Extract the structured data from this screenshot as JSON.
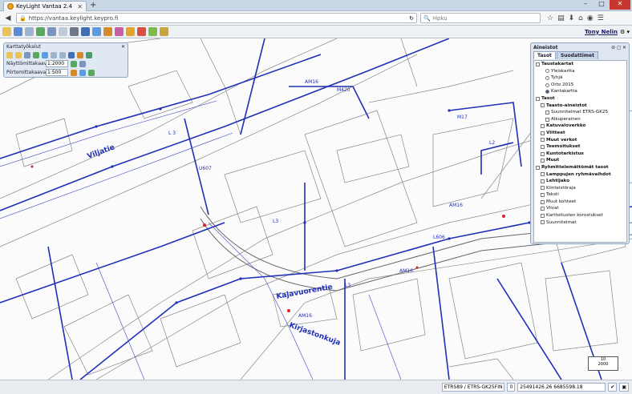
{
  "browser": {
    "tab_title": "KeyLight Vantaa 2.4",
    "new_tab": "+",
    "url": "https://vantaa.keylight.keypro.fi",
    "search_placeholder": "Hpku",
    "win_min": "–",
    "win_max": "□",
    "win_close": "✕"
  },
  "app": {
    "user": "Tony Nelin",
    "user_suffix": "⚙ ▾"
  },
  "tools": {
    "title": "Karttatyökalut",
    "close": "✕",
    "view_scale_label": "Näyttömittakaava",
    "view_scale_value": "1:2000",
    "draw_scale_label": "Piirtomittakaava",
    "draw_scale_value": "1:500"
  },
  "panel": {
    "title": "Aineistot",
    "controls": "⊘ ◻ ✕",
    "tabs": [
      "Tasot",
      "Suodattimet"
    ],
    "items": [
      {
        "kind": "tree",
        "label": "Taustakartat",
        "bold": true,
        "indent": 0
      },
      {
        "kind": "radio",
        "label": "Yleiskartta",
        "on": false,
        "indent": 2
      },
      {
        "kind": "radio",
        "label": "Tyhjä",
        "on": false,
        "indent": 2
      },
      {
        "kind": "radio",
        "label": "Orto 2015",
        "on": false,
        "indent": 2
      },
      {
        "kind": "radio",
        "label": "Kantakartta",
        "on": true,
        "indent": 2
      },
      {
        "kind": "check",
        "label": "Tasot",
        "bold": true,
        "indent": 0
      },
      {
        "kind": "check",
        "label": "Taasto-aineistot",
        "bold": true,
        "indent": 1
      },
      {
        "kind": "check",
        "label": "Suunnitelmat ETRS-GK25",
        "indent": 2
      },
      {
        "kind": "check",
        "label": "Alkuperainen",
        "indent": 2
      },
      {
        "kind": "check",
        "label": "Katuvaloverkko",
        "bold": true,
        "indent": 1
      },
      {
        "kind": "check",
        "label": "Viitteet",
        "bold": true,
        "indent": 1
      },
      {
        "kind": "check",
        "label": "Muut verkot",
        "bold": true,
        "indent": 1
      },
      {
        "kind": "check",
        "label": "Teemoitukset",
        "bold": true,
        "indent": 1
      },
      {
        "kind": "check",
        "label": "Kuntotarkistus",
        "bold": true,
        "indent": 1
      },
      {
        "kind": "check",
        "label": "Muut",
        "bold": true,
        "indent": 1
      },
      {
        "kind": "check",
        "label": "Ryhmittelemättömät tasot",
        "bold": true,
        "indent": 0
      },
      {
        "kind": "check",
        "label": "Lamppujen ryhmävaihdot",
        "bold": true,
        "indent": 1
      },
      {
        "kind": "check",
        "label": "Lehtijako",
        "bold": true,
        "indent": 1
      },
      {
        "kind": "check",
        "label": "Kiinteistöraja",
        "indent": 1
      },
      {
        "kind": "check",
        "label": "Teksti",
        "indent": 1
      },
      {
        "kind": "check",
        "label": "Muut kohteet",
        "indent": 1
      },
      {
        "kind": "check",
        "label": "Viivat",
        "indent": 1
      },
      {
        "kind": "check",
        "label": "Karttoitusten korostukset",
        "indent": 1
      },
      {
        "kind": "check",
        "label": "Suunnitelmat",
        "indent": 1
      }
    ]
  },
  "map": {
    "streets": [
      "Kajavuorentie",
      "Viljatie",
      "Kirjastonkuja"
    ],
    "labels": [
      "AM16",
      "AM16",
      "M420",
      "AM16",
      "L 3",
      "L2",
      "L3",
      "U607",
      "L606",
      "M17",
      "AM16",
      "L3"
    ],
    "scale_value": "10",
    "scale_unit": "2000"
  },
  "status": {
    "crs": "ETRS89 / ETRS-GK25FIN",
    "zero": "0",
    "coords": "25491426.26 6685598.18"
  },
  "colors": {
    "network": "#1f2fb8",
    "panel_bg": "#dde6f1",
    "accent_red": "#d42424"
  }
}
